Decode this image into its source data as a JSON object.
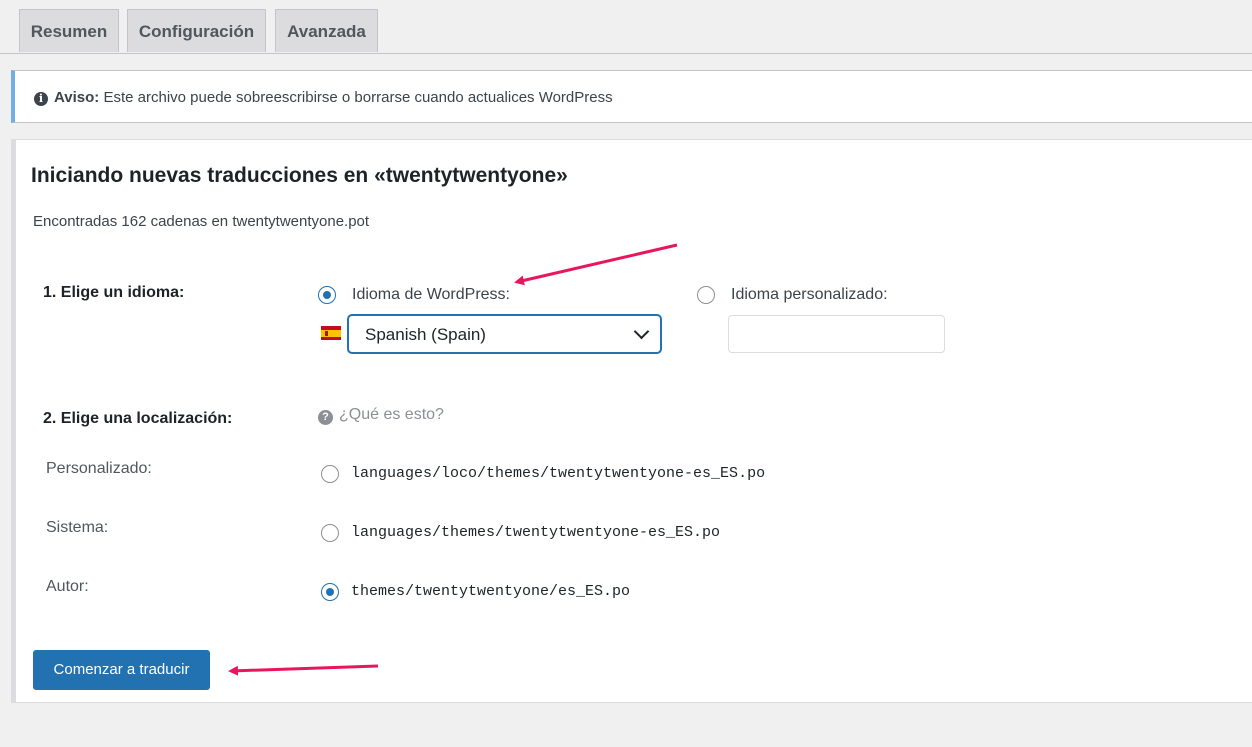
{
  "tabs": [
    "Resumen",
    "Configuración",
    "Avanzada"
  ],
  "notice": {
    "label": "Aviso:",
    "text": " Este archivo puede sobreescribirse o borrarse cuando actualices WordPress"
  },
  "heading": "Iniciando nuevas traducciones en «twentytwentyone»",
  "found_text": "Encontradas 162 cadenas en twentytwentyone.pot",
  "language": {
    "step_label": "1. Elige un idioma:",
    "wordpress_option": "Idioma de WordPress:",
    "custom_option": "Idioma personalizado:",
    "selected_value": "Spanish (Spain)",
    "custom_value": "",
    "wordpress_checked": true
  },
  "location": {
    "step_label": "2. Elige una localización:",
    "help_text": "¿Qué es esto?",
    "options": [
      {
        "label": "Personalizado:",
        "path": "languages/loco/themes/twentytwentyone-es_ES.po",
        "checked": false
      },
      {
        "label": "Sistema:",
        "path": "languages/themes/twentytwentyone-es_ES.po",
        "checked": false
      },
      {
        "label": "Autor:",
        "path": "themes/twentytwentyone/es_ES.po",
        "checked": true
      }
    ]
  },
  "submit_label": "Comenzar a traducir",
  "colors": {
    "primary": "#2271b1",
    "notice_border": "#72aee6",
    "annotation_arrow": "#e8175d"
  }
}
